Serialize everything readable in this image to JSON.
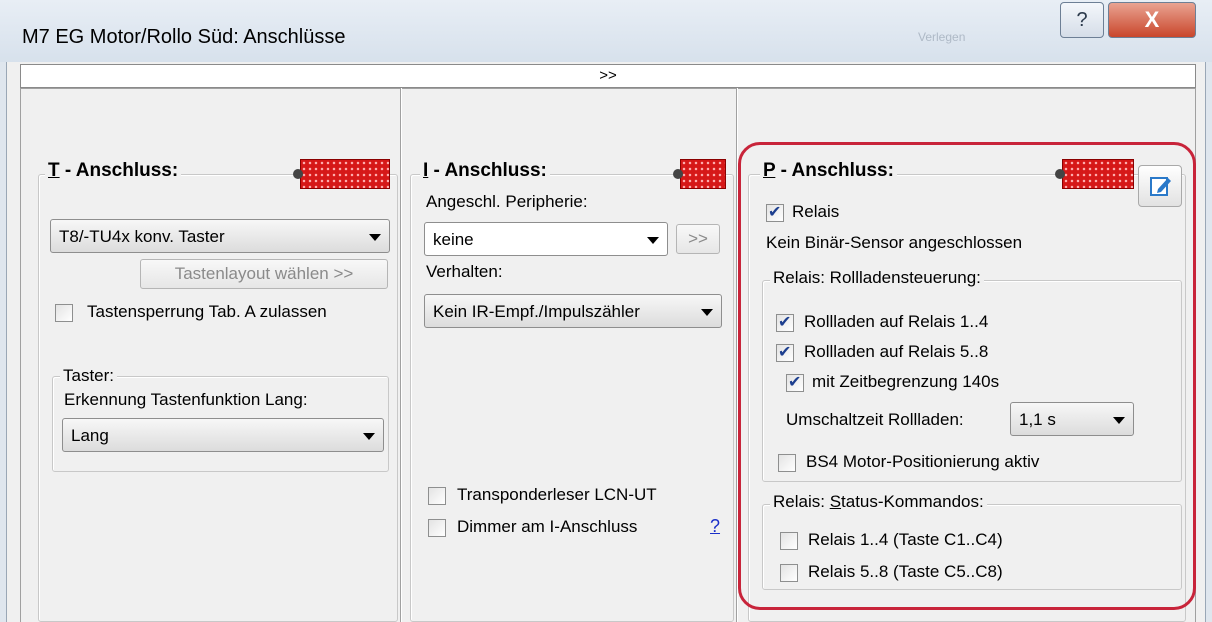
{
  "window": {
    "title": "M7 EG Motor/Rollo Süd: Anschlüsse",
    "help_button": "?",
    "close_button": "X",
    "background_text": "Verlegen"
  },
  "expander": {
    "label": ">>"
  },
  "t_anschluss": {
    "title_prefix": "T",
    "title_rest": " - Anschluss:",
    "device_select": "T8/-TU4x konv. Taster",
    "layout_button": "Tastenlayout wählen >>",
    "lock_checkbox": {
      "label": "Tastensperrung Tab. A zulassen",
      "checked": false
    },
    "taster_group": {
      "title": "Taster:",
      "label": "Erkennung Tastenfunktion Lang:",
      "select": "Lang"
    }
  },
  "i_anschluss": {
    "title_prefix": "I",
    "title_rest": " - Anschluss:",
    "peripherie_label": "Angeschl. Peripherie:",
    "peripherie_select": "keine",
    "peripherie_button": ">>",
    "verhalten_label": "Verhalten:",
    "verhalten_select": "Kein IR-Empf./Impulszähler",
    "transponder_checkbox": {
      "label": "Transponderleser LCN-UT",
      "checked": false
    },
    "dimmer_checkbox": {
      "label": "Dimmer am I-Anschluss",
      "checked": false
    },
    "help_link": "?"
  },
  "p_anschluss": {
    "title_prefix": "P",
    "title_rest": " - Anschluss:",
    "relais_checkbox": {
      "label": "Relais",
      "checked": true
    },
    "sensor_text": "Kein Binär-Sensor angeschlossen",
    "rollladen_group": {
      "title": "Relais: Rollladensteuerung:",
      "cb_1_4": {
        "label": "Rollladen auf Relais 1..4",
        "checked": true
      },
      "cb_5_8": {
        "label": "Rollladen auf Relais 5..8",
        "checked": true
      },
      "cb_zeit": {
        "label": "mit Zeitbegrenzung 140s",
        "checked": true
      },
      "umschalt_label": "Umschaltzeit Rollladen:",
      "umschalt_select": "1,1 s",
      "cb_bs4": {
        "label": "BS4 Motor-Positionierung aktiv",
        "checked": false
      }
    },
    "status_group": {
      "title_prefix": "Relais: ",
      "title_underlined": "S",
      "title_rest": "tatus-Kommandos:",
      "cb_c1": {
        "label": "Relais 1..4 (Taste C1..C4)",
        "checked": false
      },
      "cb_c5": {
        "label": "Relais 5..8 (Taste C5..C8)",
        "checked": false
      }
    }
  },
  "colors": {
    "highlight": "#c8243a",
    "module": "#d61818",
    "checkmark": "#1d3f8f",
    "link": "#1a2fc8"
  }
}
